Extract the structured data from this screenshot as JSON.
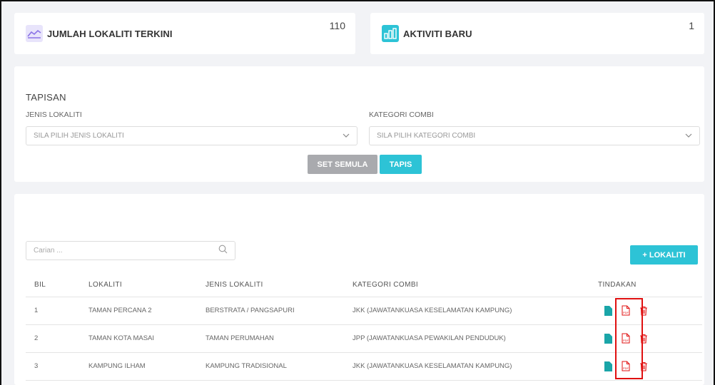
{
  "stats": [
    {
      "label": "JUMLAH LOKALITI TERKINI",
      "value": "110",
      "icon": "trend-line-icon"
    },
    {
      "label": "AKTIVITI BARU",
      "value": "1",
      "icon": "bar-chart-icon"
    }
  ],
  "filter": {
    "title": "TAPISAN",
    "jenis_label": "JENIS LOKALITI",
    "jenis_placeholder": "SILA PILIH JENIS LOKALITI",
    "kategori_label": "KATEGORI COMBI",
    "kategori_placeholder": "SILA PILIH KATEGORI COMBI",
    "reset_label": "SET SEMULA",
    "apply_label": "TAPIS"
  },
  "list": {
    "search_placeholder": "Carian ...",
    "add_label": "+ LOKALITI",
    "headers": [
      "BIL",
      "LOKALITI",
      "JENIS LOKALITI",
      "KATEGORI COMBI",
      "TINDAKAN"
    ],
    "rows": [
      {
        "bil": "1",
        "lokaliti": "TAMAN PERCANA 2",
        "jenis": "BERSTRATA / PANGSAPURI",
        "kategori": "JKK (JAWATANKUASA KESELAMATAN KAMPUNG)"
      },
      {
        "bil": "2",
        "lokaliti": "TAMAN KOTA MASAI",
        "jenis": "TAMAN PERUMAHAN",
        "kategori": "JPP (JAWATANKUASA PEWAKILAN PENDUDUK)"
      },
      {
        "bil": "3",
        "lokaliti": "KAMPUNG ILHAM",
        "jenis": "KAMPUNG TRADISIONAL",
        "kategori": "JKK (JAWATANKUASA KESELAMATAN KAMPUNG)"
      }
    ]
  },
  "colors": {
    "accent": "#2dc3d6",
    "danger": "#e01010",
    "file": "#1aa5a8",
    "reset": "#a9aaae"
  }
}
